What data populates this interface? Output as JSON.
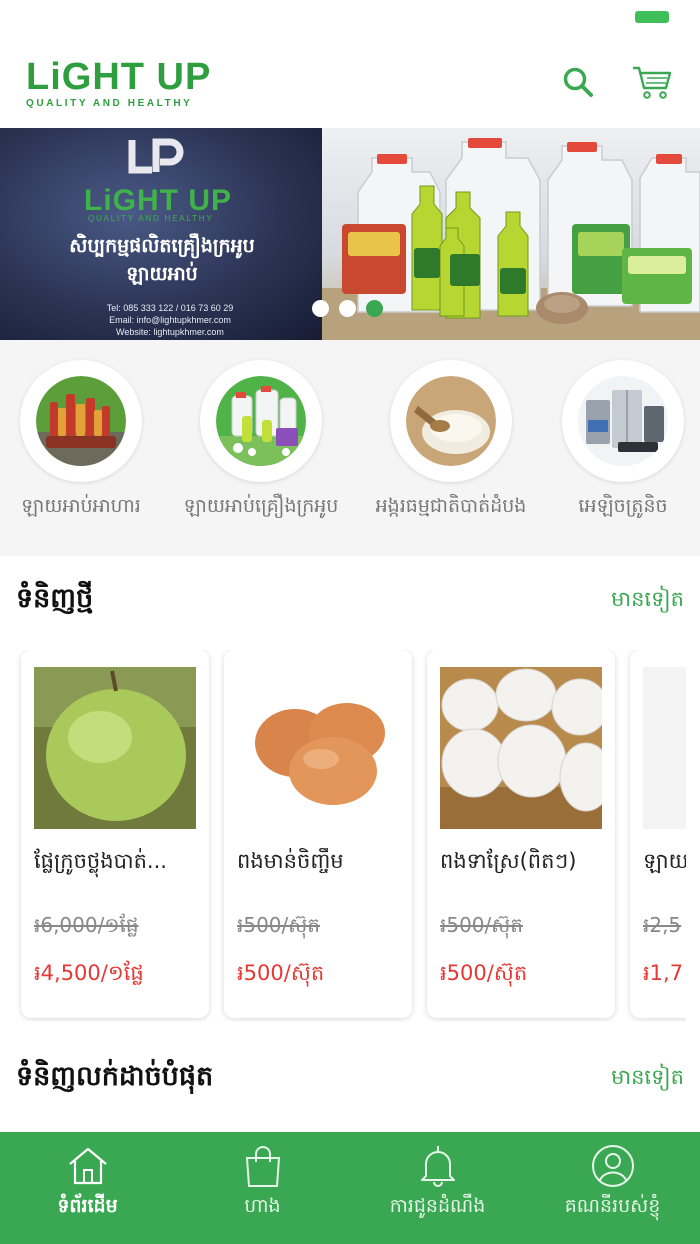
{
  "colors": {
    "primary": "#3aa852",
    "sale_price": "#e53935",
    "logo_accent": "#d8292f"
  },
  "header": {
    "logo_word1": "LiGHT",
    "logo_word2": "UP",
    "logo_tagline": "QUALITY AND HEALTHY",
    "search_icon": "search-icon",
    "cart_icon": "cart-icon"
  },
  "banner": {
    "brand": "LiGHT UP",
    "brand_sub": "QUALITY AND HEALTHY",
    "tagline_line1": "សិប្បកម្មផលិតគ្រឿងក្រអូប",
    "tagline_line2": "ឡាយអាប់",
    "contact_tel": "Tel: 085 333 122 / 016 73 60 29",
    "contact_email": "Email: info@lightupkhmer.com",
    "contact_web": "Website: lightupkhmer.com",
    "slide_count": 3,
    "active_slide": 3
  },
  "categories": [
    {
      "label": "ឡាយអាប់អាហារ",
      "icon": "food-products-image"
    },
    {
      "label": "ឡាយអាប់គ្រឿងក្រអូប",
      "icon": "cleaning-products-image"
    },
    {
      "label": "អង្ករធម្មជាតិបាត់ដំបង",
      "icon": "rice-image"
    },
    {
      "label": "អេឡិចត្រូនិច",
      "icon": "electronics-image"
    }
  ],
  "new_products": {
    "title": "ទំនិញថ្មី",
    "more": "មានទៀត",
    "items": [
      {
        "name": "ផ្លែក្រូចថ្លុងបាត់...",
        "old_price": "៛6,000/១ផ្លែ",
        "price": "៛4,500/១ផ្លែ",
        "image": "pomelo-image"
      },
      {
        "name": "ពងមាន់ចិញ្ចឹម",
        "old_price": "៛500/ស៊ុត",
        "price": "៛500/ស៊ុត",
        "image": "chicken-eggs-image"
      },
      {
        "name": "ពងទាស្រែ(ពិតៗ)",
        "old_price": "៛500/ស៊ុត",
        "price": "៛500/ស៊ុត",
        "image": "duck-eggs-image"
      },
      {
        "name": "ឡាយ",
        "old_price": "៛2,5",
        "price": "៛1,7",
        "image": "partial-product-image"
      }
    ]
  },
  "best_sellers": {
    "title": "ទំនិញលក់ដាច់បំផុត",
    "more": "មានទៀត"
  },
  "bottom_nav": [
    {
      "label": "ទំព័រដើម",
      "icon": "home-icon",
      "active": true
    },
    {
      "label": "ហាង",
      "icon": "shopping-bag-icon",
      "active": false
    },
    {
      "label": "ការជូនដំណឹង",
      "icon": "bell-icon",
      "active": false
    },
    {
      "label": "គណនីរបស់ខ្ញុំ",
      "icon": "user-icon",
      "active": false
    }
  ]
}
